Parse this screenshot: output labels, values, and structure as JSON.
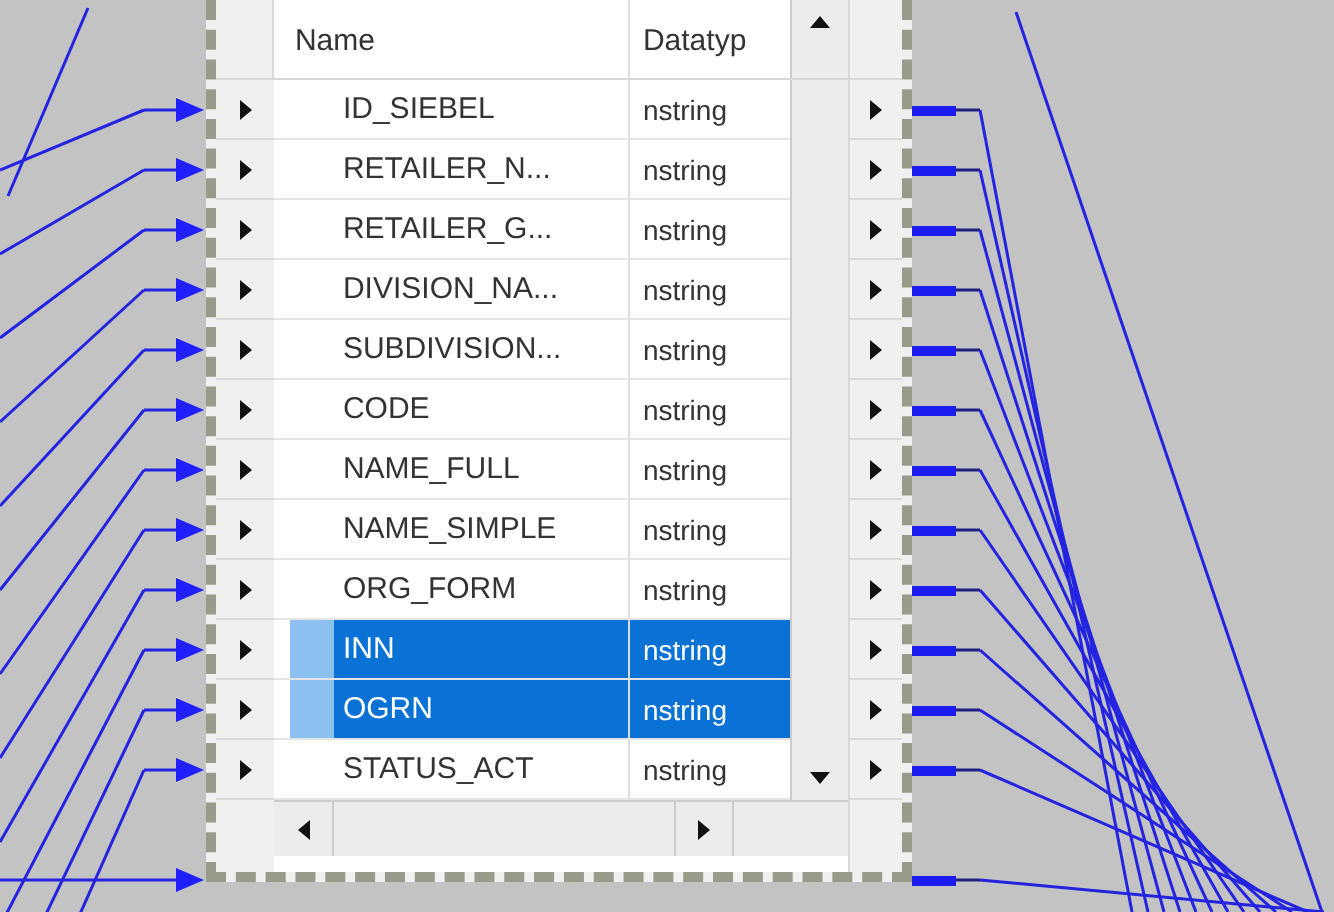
{
  "columns": [
    "Name",
    "Datatyp"
  ],
  "rows": [
    {
      "name": "ID_SIEBEL",
      "datatype": "nstring",
      "selected": false
    },
    {
      "name": "RETAILER_N...",
      "datatype": "nstring",
      "selected": false
    },
    {
      "name": "RETAILER_G...",
      "datatype": "nstring",
      "selected": false
    },
    {
      "name": "DIVISION_NA...",
      "datatype": "nstring",
      "selected": false
    },
    {
      "name": "SUBDIVISION...",
      "datatype": "nstring",
      "selected": false
    },
    {
      "name": "CODE",
      "datatype": "nstring",
      "selected": false
    },
    {
      "name": "NAME_FULL",
      "datatype": "nstring",
      "selected": false
    },
    {
      "name": "NAME_SIMPLE",
      "datatype": "nstring",
      "selected": false
    },
    {
      "name": "ORG_FORM",
      "datatype": "nstring",
      "selected": false
    },
    {
      "name": "INN",
      "datatype": "nstring",
      "selected": true
    },
    {
      "name": "OGRN",
      "datatype": "nstring",
      "selected": true
    },
    {
      "name": "STATUS_ACT",
      "datatype": "nstring",
      "selected": false
    }
  ]
}
